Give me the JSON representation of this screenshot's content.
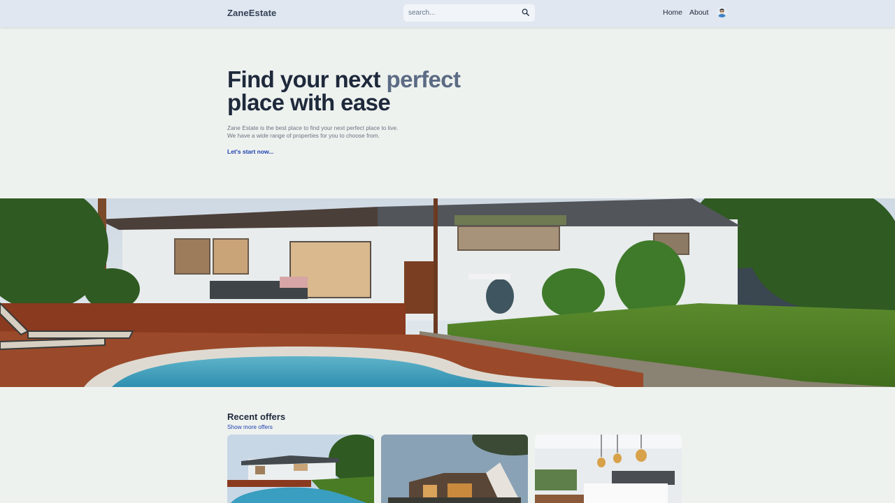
{
  "header": {
    "logo": "ZaneEstate",
    "search": {
      "placeholder": "search..."
    },
    "nav": {
      "home": "Home",
      "about": "About"
    }
  },
  "hero": {
    "title_part1": "Find your next ",
    "title_accent": "perfect",
    "title_part2": "place with ease",
    "description_line1": "Zane Estate is the best place to find your next perfect place to live.",
    "description_line2": "We have a wide range of properties for you to choose from.",
    "cta": "Let's start now..."
  },
  "offers": {
    "title": "Recent offers",
    "show_more": "Show more offers"
  },
  "colors": {
    "header_bg": "#e0e7f0",
    "page_bg": "#eef2ef",
    "accent_text": "#5b6b84",
    "link": "#1e40af"
  }
}
